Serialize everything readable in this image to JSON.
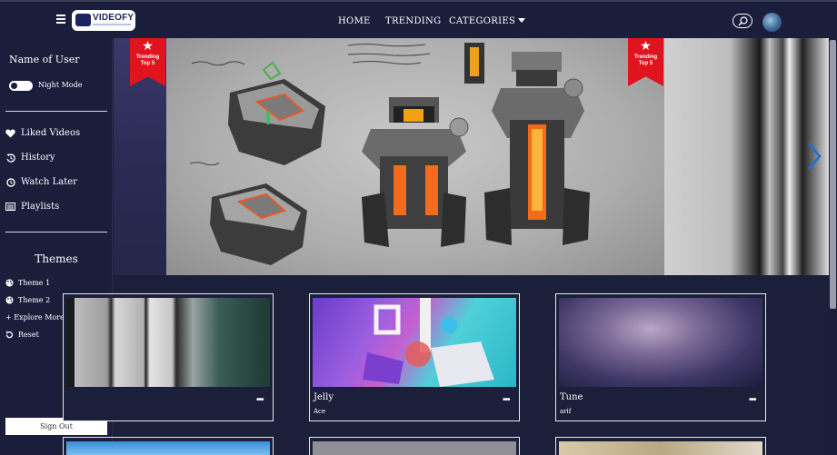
{
  "app": {
    "logo_text": "VIDEOFY"
  },
  "nav": {
    "links": [
      {
        "label": "HOME"
      },
      {
        "label": "TRENDING"
      },
      {
        "label": "CATEGORIES"
      }
    ]
  },
  "sidebar": {
    "user_name": "Name of User",
    "night_mode_label": "Night Mode",
    "night_mode_on": false,
    "items": [
      {
        "label": "Liked Videos",
        "icon": "heart-icon"
      },
      {
        "label": "History",
        "icon": "history-icon"
      },
      {
        "label": "Watch Later",
        "icon": "clock-icon"
      },
      {
        "label": "Playlists",
        "icon": "playlist-icon"
      }
    ],
    "themes_title": "Themes",
    "themes": [
      {
        "label": "Theme 1",
        "icon": "palette-icon"
      },
      {
        "label": "Theme 2",
        "icon": "palette-icon"
      },
      {
        "label": "+ Explore More"
      },
      {
        "label": "Reset",
        "icon": "reset-icon"
      }
    ],
    "sign_out": "Sign Out"
  },
  "hero": {
    "badges": [
      {
        "line1": "Trending",
        "line2": "Top 5"
      },
      {
        "line1": "Trending",
        "line2": "Top 5"
      }
    ]
  },
  "videos": [
    {
      "title": "",
      "author": ""
    },
    {
      "title": "Jelly",
      "author": "Ace"
    },
    {
      "title": "Tune",
      "author": "arif"
    }
  ],
  "colors": {
    "background": "#1b1f3a",
    "ribbon": "#e0141e",
    "accent_arrow": "#1e6fd9"
  }
}
